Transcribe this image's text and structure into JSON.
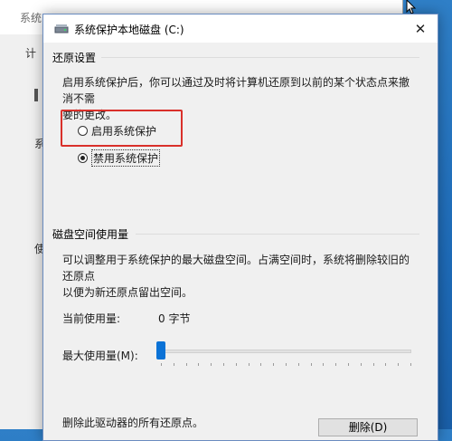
{
  "background_window": {
    "title": "系统",
    "tab": "计",
    "side_texts": [
      "系",
      "使"
    ]
  },
  "dialog": {
    "title": "系统保护本地磁盘 (C:)",
    "close_glyph": "✕",
    "restore_settings": {
      "heading": "还原设置",
      "description_line1": "启用系统保护后，你可以通过及时将计算机还原到以前的某个状态点来撤消不需",
      "description_line2": "要的更改。",
      "options": [
        {
          "label": "启用系统保护",
          "checked": false
        },
        {
          "label": "禁用系统保护",
          "checked": true
        }
      ]
    },
    "disk_usage": {
      "heading": "磁盘空间使用量",
      "description_line1": "可以调整用于系统保护的最大磁盘空间。占满空间时，系统将删除较旧的还原点",
      "description_line2": "以便为新还原点留出空间。",
      "current_usage_label": "当前使用量:",
      "current_usage_value": "0 字节",
      "max_usage_label": "最大使用量(M):",
      "max_usage_fraction": 0.0
    },
    "delete_text": "删除此驱动器的所有还原点。",
    "delete_button": "删除(D)"
  },
  "colors": {
    "highlight": "#d9302a",
    "slider_thumb": "#0b72d6",
    "desktop": "#1e6bb8"
  }
}
